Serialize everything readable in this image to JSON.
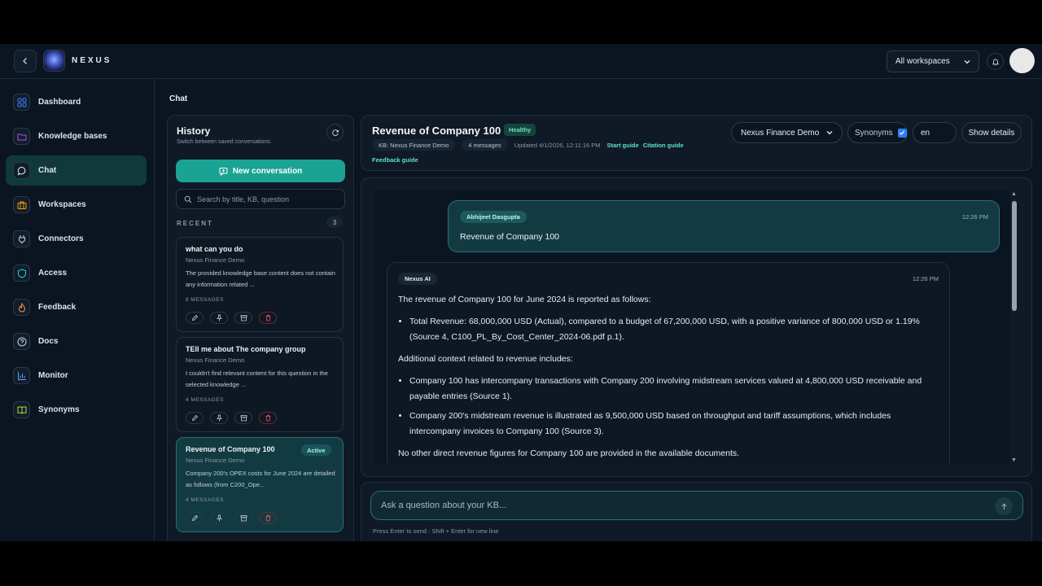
{
  "topbar": {
    "brand": "NEXUS",
    "workspace_select": "All workspaces"
  },
  "sidebar": {
    "items": [
      {
        "label": "Dashboard",
        "icon": "grid-icon",
        "color": "#3b82f6"
      },
      {
        "label": "Knowledge bases",
        "icon": "folder-icon",
        "color": "#a855f7"
      },
      {
        "label": "Chat",
        "icon": "chat-bubble-icon",
        "color": "#e6edf3",
        "active": true
      },
      {
        "label": "Workspaces",
        "icon": "briefcase-icon",
        "color": "#f59e0b"
      },
      {
        "label": "Connectors",
        "icon": "plug-icon",
        "color": "#cbd5e1"
      },
      {
        "label": "Access",
        "icon": "shield-icon",
        "color": "#22d3ee"
      },
      {
        "label": "Feedback",
        "icon": "flame-icon",
        "color": "#fb923c"
      },
      {
        "label": "Docs",
        "icon": "help-circle-icon",
        "color": "#cbd5e1"
      },
      {
        "label": "Monitor",
        "icon": "bar-chart-icon",
        "color": "#60a5fa"
      },
      {
        "label": "Synonyms",
        "icon": "book-icon",
        "color": "#a3e635"
      }
    ]
  },
  "page": {
    "title": "Chat"
  },
  "history": {
    "title": "History",
    "subtitle": "Switch between saved conversations.",
    "new_conversation": "New conversation",
    "search_placeholder": "Search by title, KB, question",
    "recent_label": "RECENT",
    "recent_count": "3",
    "conversations": [
      {
        "title": "what can you do",
        "kb": "Nexus Finance Demo",
        "preview": "The provided knowledge base content does not contain any information related ...",
        "messages": "8 MESSAGES"
      },
      {
        "title": "TEll me about The company group",
        "kb": "Nexus Finance Demo",
        "preview": "I couldn't find relevant content for this question in the selected knowledge ...",
        "messages": "4 MESSAGES"
      },
      {
        "title": "Revenue of Company 100",
        "kb": "Nexus Finance Demo",
        "preview": "Company 200's OPEX costs for June 2024 are detailed as follows (from C200_Ope...",
        "messages": "4 MESSAGES",
        "badge": "Active"
      }
    ]
  },
  "header": {
    "title": "Revenue of Company 100",
    "health": "Healthy",
    "kb_pill": "KB: Nexus Finance Demo",
    "messages_pill": "4 messages",
    "updated": "Updated 4/1/2026, 12:11:16 PM",
    "start_guide": "Start guide",
    "citation_guide": "Citation guide",
    "feedback_guide": "Feedback guide",
    "kb_select": "Nexus Finance Demo",
    "synonyms_label": "Synonyms",
    "synonyms_checked": true,
    "language": "en",
    "show_details": "Show details"
  },
  "chat": {
    "user_message": {
      "author": "Abhijeet Dasgupta",
      "time": "12:26 PM",
      "text": "Revenue of Company 100"
    },
    "ai_message": {
      "author": "Nexus AI",
      "time": "12:26 PM",
      "intro": "The revenue of Company 100 for June 2024 is reported as follows:",
      "bullets1": [
        "Total Revenue: 68,000,000 USD (Actual), compared to a budget of 67,200,000 USD, with a positive variance of 800,000 USD or 1.19% (Source 4, C100_PL_By_Cost_Center_2024-06.pdf p.1)."
      ],
      "context": "Additional context related to revenue includes:",
      "bullets2": [
        "Company 100 has intercompany transactions with Company 200 involving midstream services valued at 4,800,000 USD receivable and payable entries (Source 1).",
        "Company 200's midstream revenue is illustrated as 9,500,000 USD based on throughput and tariff assumptions, which includes intercompany invoices to Company 100 (Source 3)."
      ],
      "closing": "No other direct revenue figures for Company 100 are provided in the available documents."
    }
  },
  "composer": {
    "placeholder": "Ask a question about your KB...",
    "hint": "Press Enter to send · Shift + Enter for new line"
  }
}
